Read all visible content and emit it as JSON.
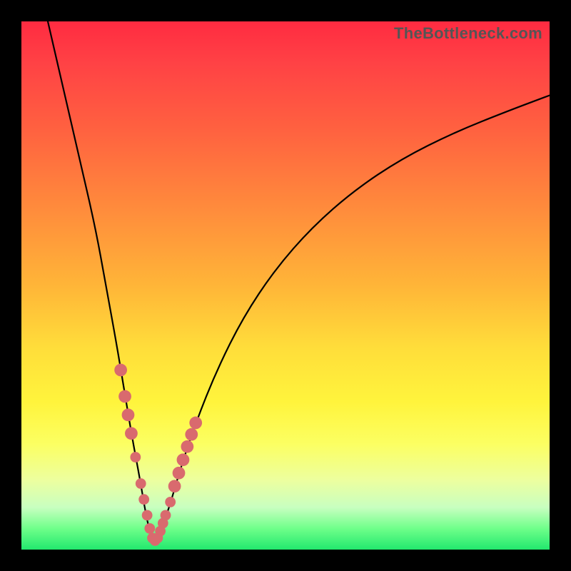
{
  "watermark": "TheBottleneck.com",
  "colors": {
    "frame_bg": "#000000",
    "curve": "#000000",
    "marker": "#d96a6e",
    "gradient_top": "#ff2b41",
    "gradient_mid": "#ffde3a",
    "gradient_bottom": "#22e86e"
  },
  "chart_data": {
    "type": "line",
    "title": "",
    "xlabel": "",
    "ylabel": "",
    "xlim": [
      0,
      100
    ],
    "ylim": [
      0,
      100
    ],
    "grid": false,
    "legend": false,
    "series": [
      {
        "name": "bottleneck-curve",
        "x": [
          5,
          8,
          11,
          14,
          16,
          18,
          19.5,
          21,
          22.5,
          23.5,
          24.5,
          25,
          26,
          28,
          30,
          33,
          37,
          42,
          48,
          55,
          63,
          72,
          82,
          92,
          100
        ],
        "values": [
          100,
          87,
          74,
          61,
          50,
          39,
          30,
          21,
          13,
          7,
          2.5,
          1.5,
          2.5,
          8,
          15,
          24,
          34,
          44,
          53,
          61,
          68,
          74,
          79,
          83,
          86
        ]
      }
    ],
    "markers": [
      {
        "x": 18.8,
        "y": 34,
        "r": 1.2
      },
      {
        "x": 19.6,
        "y": 29,
        "r": 1.2
      },
      {
        "x": 20.2,
        "y": 25.5,
        "r": 1.2
      },
      {
        "x": 20.8,
        "y": 22,
        "r": 1.2
      },
      {
        "x": 21.6,
        "y": 17.5,
        "r": 1.0
      },
      {
        "x": 22.6,
        "y": 12.5,
        "r": 1.0
      },
      {
        "x": 23.2,
        "y": 9.5,
        "r": 1.0
      },
      {
        "x": 23.8,
        "y": 6.5,
        "r": 1.0
      },
      {
        "x": 24.3,
        "y": 4.0,
        "r": 1.0
      },
      {
        "x": 24.8,
        "y": 2.2,
        "r": 1.0
      },
      {
        "x": 25.3,
        "y": 1.7,
        "r": 1.0
      },
      {
        "x": 25.8,
        "y": 2.2,
        "r": 1.0
      },
      {
        "x": 26.3,
        "y": 3.5,
        "r": 1.0
      },
      {
        "x": 26.8,
        "y": 5.0,
        "r": 1.0
      },
      {
        "x": 27.3,
        "y": 6.5,
        "r": 1.0
      },
      {
        "x": 28.2,
        "y": 9.0,
        "r": 1.0
      },
      {
        "x": 29.0,
        "y": 12.0,
        "r": 1.2
      },
      {
        "x": 29.8,
        "y": 14.5,
        "r": 1.2
      },
      {
        "x": 30.6,
        "y": 17.0,
        "r": 1.2
      },
      {
        "x": 31.4,
        "y": 19.5,
        "r": 1.2
      },
      {
        "x": 32.2,
        "y": 21.8,
        "r": 1.2
      },
      {
        "x": 33.0,
        "y": 24.0,
        "r": 1.2
      }
    ],
    "annotations": []
  }
}
